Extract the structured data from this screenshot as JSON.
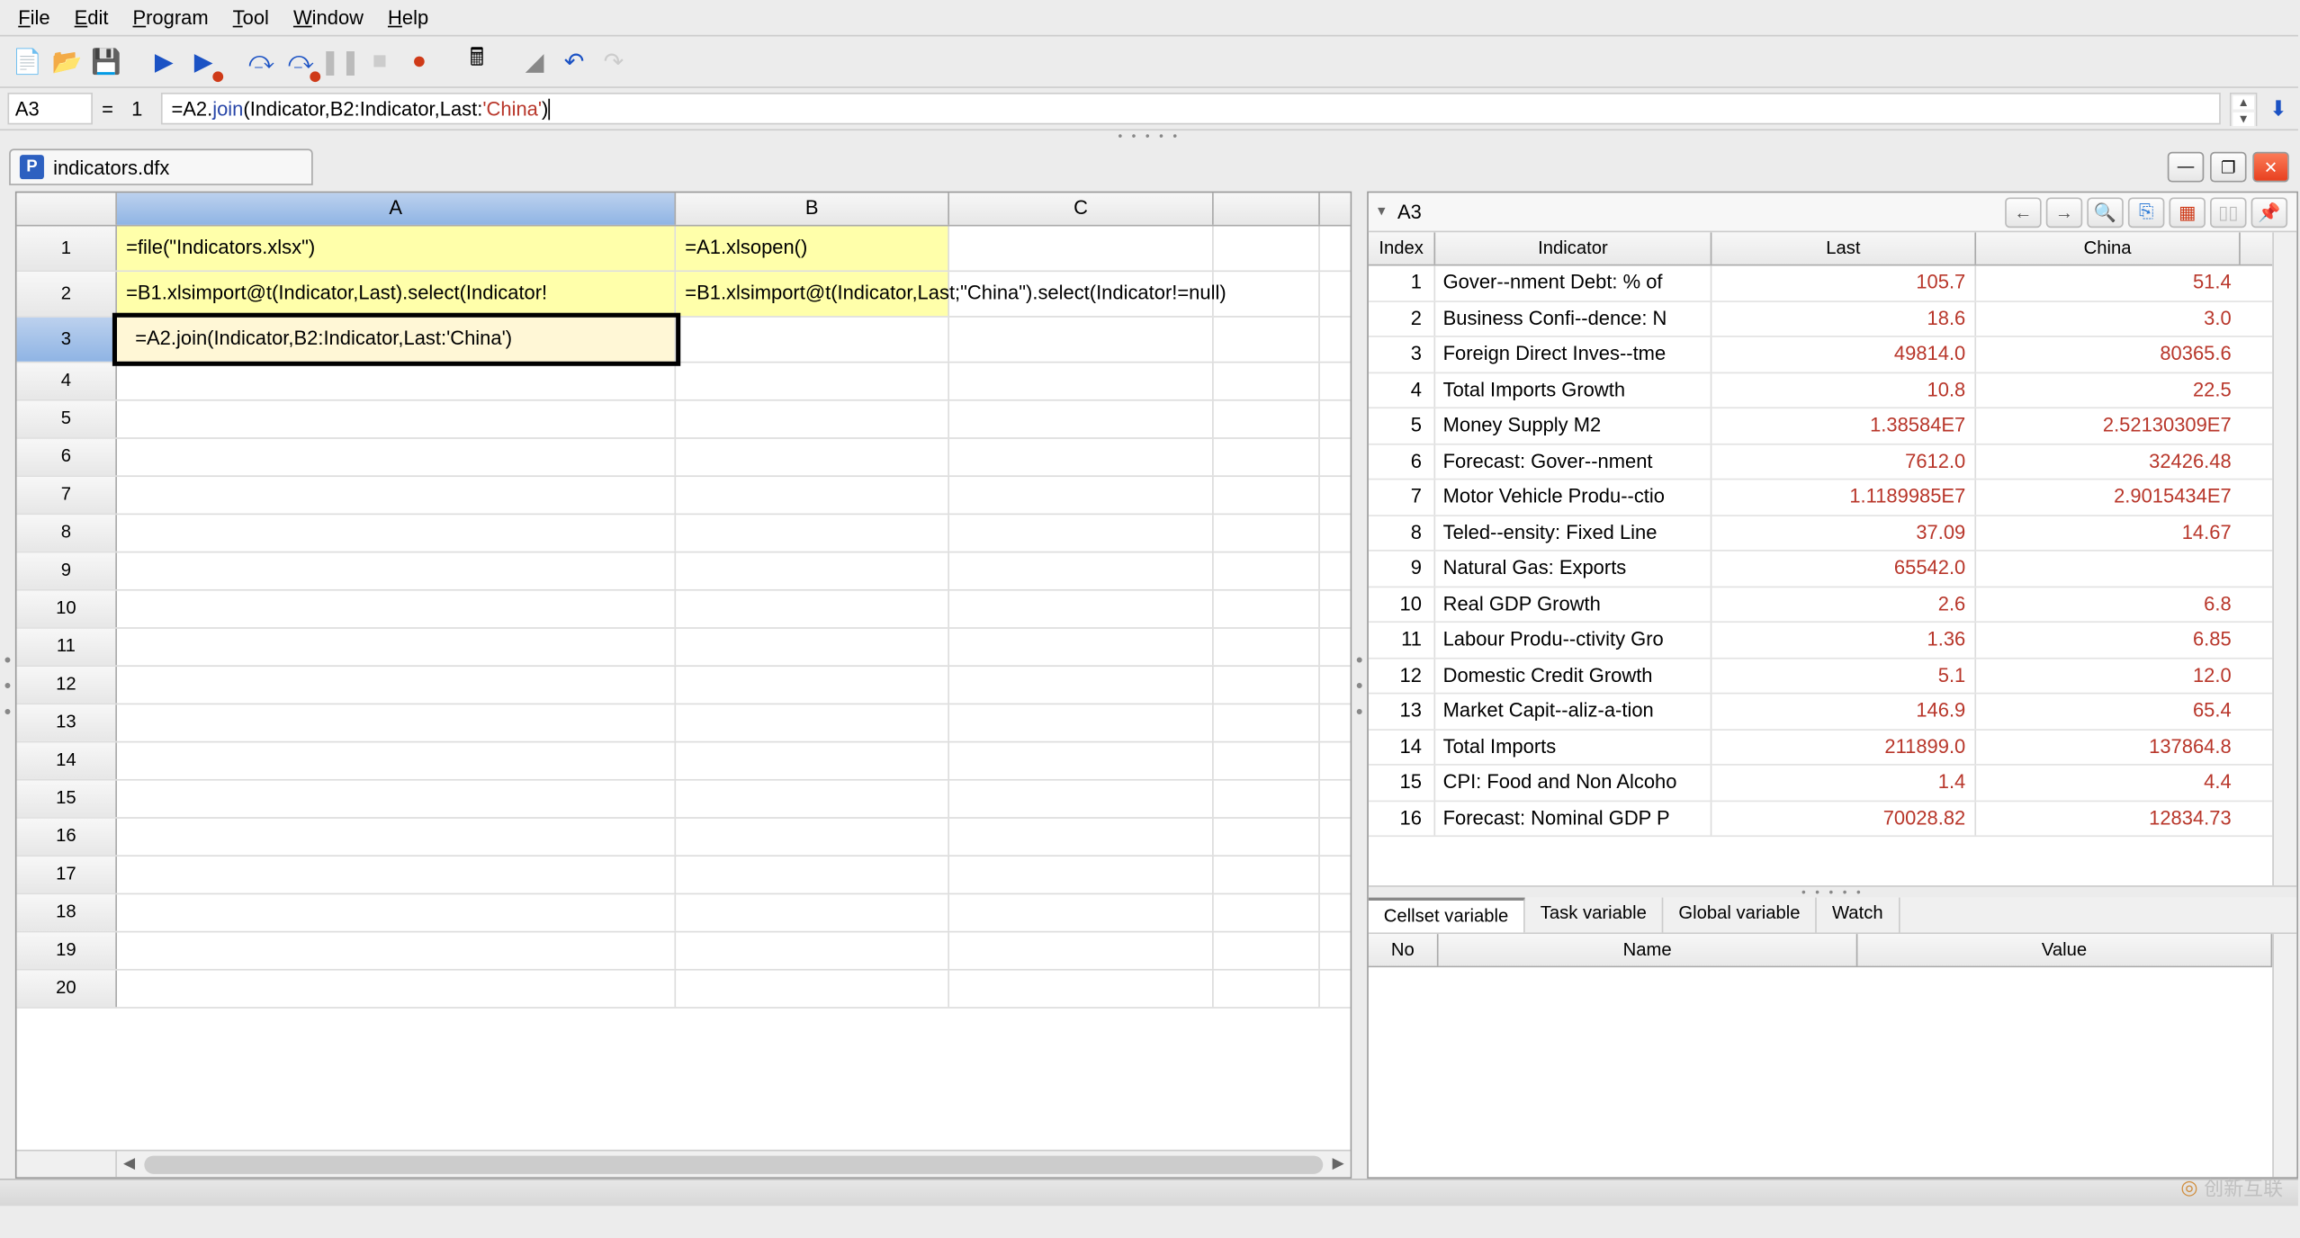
{
  "menu": {
    "file": "File",
    "edit": "Edit",
    "program": "Program",
    "tool": "Tool",
    "window": "Window",
    "help": "Help"
  },
  "formulabar": {
    "cellref": "A3",
    "rownum": "1",
    "formula_plain": "=A2.join(Indicator,B2:Indicator,Last:'China')",
    "f_kw_join": "join",
    "f_str": "'China'"
  },
  "doc": {
    "p": "P",
    "name": "indicators.dfx"
  },
  "grid": {
    "cols": [
      "A",
      "B",
      "C"
    ],
    "rows": [
      {
        "n": "1",
        "A": "=file(\"Indicators.xlsx\")",
        "B": "=A1.xlsopen()",
        "C": ""
      },
      {
        "n": "2",
        "A": "=B1.xlsimport@t(Indicator,Last).select(Indicator!",
        "B": "=B1.xlsimport@t(Indicator,Last;\"China\").select(Indicator!=null)",
        "C": ""
      },
      {
        "n": "3",
        "A": "=A2.join(Indicator,B2:Indicator,Last:'China')",
        "B": "",
        "C": ""
      }
    ],
    "emptyRows": [
      "4",
      "5",
      "6",
      "7",
      "8",
      "9",
      "10",
      "11",
      "12",
      "13",
      "14",
      "15",
      "16",
      "17",
      "18",
      "19",
      "20"
    ]
  },
  "right": {
    "cell": "A3",
    "headers": {
      "index": "Index",
      "indicator": "Indicator",
      "last": "Last",
      "china": "China"
    },
    "rows": [
      {
        "i": "1",
        "ind": "Gover­­--nment Debt: % of",
        "last": "105.7",
        "china": "51.4"
      },
      {
        "i": "2",
        "ind": "Business Confi--dence: N",
        "last": "18.6",
        "china": "3.0"
      },
      {
        "i": "3",
        "ind": "Foreign Direct Inves--tme",
        "last": "49814.0",
        "china": "80365.6"
      },
      {
        "i": "4",
        "ind": "Total Imports Growth",
        "last": "10.8",
        "china": "22.5"
      },
      {
        "i": "5",
        "ind": "Money Supply M2",
        "last": "1.38584E7",
        "china": "2.52130309E7"
      },
      {
        "i": "6",
        "ind": "Forecast: Gover--nment ",
        "last": "7612.0",
        "china": "32426.48"
      },
      {
        "i": "7",
        "ind": "Motor Vehicle Produ--ctio",
        "last": "1.1189985E7",
        "china": "2.9015434E7"
      },
      {
        "i": "8",
        "ind": "Teled--ensity: Fixed Line",
        "last": "37.09",
        "china": "14.67"
      },
      {
        "i": "9",
        "ind": "Natural Gas: Exports",
        "last": "65542.0",
        "china": ""
      },
      {
        "i": "10",
        "ind": "Real GDP Growth",
        "last": "2.6",
        "china": "6.8"
      },
      {
        "i": "11",
        "ind": "Labour Produ--ctivity Gro",
        "last": "1.36",
        "china": "6.85"
      },
      {
        "i": "12",
        "ind": "Domestic Credit Growth",
        "last": "5.1",
        "china": "12.0"
      },
      {
        "i": "13",
        "ind": "Market Capit--aliz-a-tion",
        "last": "146.9",
        "china": "65.4"
      },
      {
        "i": "14",
        "ind": "Total Imports",
        "last": "211899.0",
        "china": "137864.8"
      },
      {
        "i": "15",
        "ind": "CPI: Food and Non Alcoho",
        "last": "1.4",
        "china": "4.4"
      },
      {
        "i": "16",
        "ind": "Forecast: Nominal GDP P",
        "last": "70028.82",
        "china": "12834.73"
      }
    ]
  },
  "vartabs": {
    "cellset": "Cellset variable",
    "task": "Task variable",
    "global": "Global variable",
    "watch": "Watch"
  },
  "varhdr": {
    "no": "No",
    "name": "Name",
    "value": "Value"
  },
  "watermark": "创新互联"
}
